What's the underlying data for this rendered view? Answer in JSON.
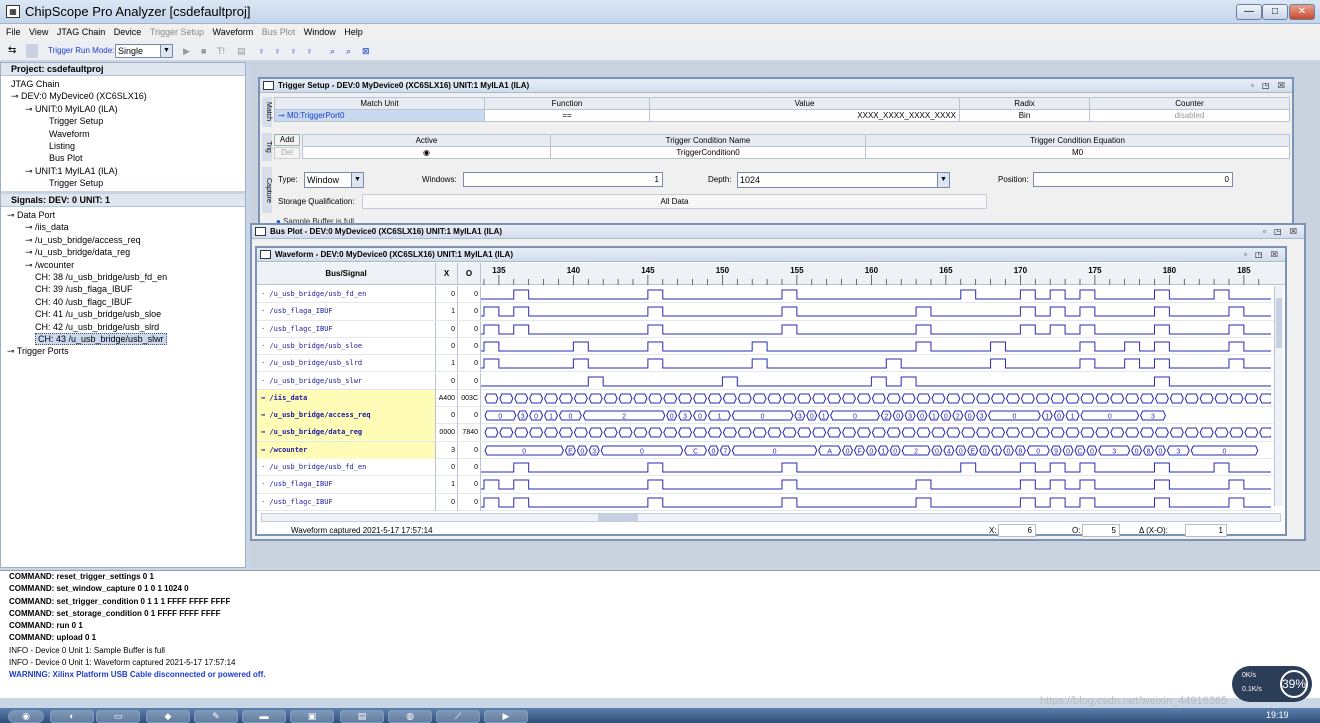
{
  "app": {
    "title": "ChipScope Pro Analyzer [csdefaultproj]"
  },
  "menu": [
    "File",
    "View",
    "JTAG Chain",
    "Device",
    "Trigger Setup",
    "Waveform",
    "Bus Plot",
    "Window",
    "Help"
  ],
  "toolbar": {
    "run_mode_label": "Trigger Run Mode:",
    "run_mode_value": "Single",
    "t_label": "T!"
  },
  "project": {
    "title": "Project: csdefaultproj",
    "tree": [
      "JTAG Chain",
      "DEV:0 MyDevice0 (XC6SLX16)",
      "UNIT:0 MyILA0 (ILA)",
      "Trigger Setup",
      "Waveform",
      "Listing",
      "Bus Plot",
      "UNIT:1 MyILA1 (ILA)",
      "Trigger Setup"
    ]
  },
  "signals": {
    "title": "Signals: DEV: 0 UNIT: 1",
    "tree": [
      "Data Port",
      "/iis_data",
      "/u_usb_bridge/access_req",
      "/u_usb_bridge/data_reg",
      "/wcounter",
      "CH: 38 /u_usb_bridge/usb_fd_en",
      "CH: 39 /usb_flaga_IBUF",
      "CH: 40 /usb_flagc_IBUF",
      "CH: 41 /u_usb_bridge/usb_sloe",
      "CH: 42 /u_usb_bridge/usb_slrd",
      "CH: 43 /u_usb_bridge/usb_slwr",
      "Trigger Ports"
    ]
  },
  "trigger_setup": {
    "title": "Trigger Setup - DEV:0 MyDevice0 (XC6SLX16) UNIT:1 MyILA1 (ILA)",
    "match_headers": [
      "Match Unit",
      "Function",
      "Value",
      "Radix",
      "Counter"
    ],
    "match_row": [
      "M0:TriggerPort0",
      "==",
      "XXXX_XXXX_XXXX_XXXX",
      "Bin",
      "disabled"
    ],
    "side_match": "Match",
    "side_trig": "Trig",
    "side_capture": "Capture",
    "add": "Add",
    "del": "Del",
    "trig_headers": [
      "Active",
      "Trigger Condition Name",
      "Trigger Condition Equation"
    ],
    "trig_row": [
      "◉",
      "TriggerCondition0",
      "M0"
    ],
    "type_label": "Type:",
    "type_value": "Window",
    "windows_label": "Windows:",
    "windows_value": "1",
    "depth_label": "Depth:",
    "depth_value": "1024",
    "position_label": "Position:",
    "position_value": "0",
    "storage_label": "Storage Qualification:",
    "storage_value": "All Data",
    "buffer_status": "Sample Buffer is full"
  },
  "bus_plot": {
    "title": "Bus Plot - DEV:0 MyDevice0 (XC6SLX16) UNIT:1 MyILA1 (ILA)"
  },
  "waveform": {
    "title": "Waveform - DEV:0 MyDevice0 (XC6SLX16) UNIT:1 MyILA1 (ILA)",
    "col_signal": "Bus/Signal",
    "col_x": "X",
    "col_o": "O",
    "ticks": [
      "135",
      "140",
      "145",
      "150",
      "155",
      "160",
      "165",
      "170",
      "175",
      "180",
      "185"
    ],
    "rows": [
      {
        "name": "/u_usb_bridge/usb_fd_en",
        "x": "0",
        "o": "0",
        "bus": false
      },
      {
        "name": "/usb_flaga_IBUF",
        "x": "1",
        "o": "0",
        "bus": false
      },
      {
        "name": "/usb_flagc_IBUF",
        "x": "0",
        "o": "0",
        "bus": false
      },
      {
        "name": "/u_usb_bridge/usb_sloe",
        "x": "0",
        "o": "0",
        "bus": false
      },
      {
        "name": "/u_usb_bridge/usb_slrd",
        "x": "1",
        "o": "0",
        "bus": false
      },
      {
        "name": "/u_usb_bridge/usb_slwr",
        "x": "0",
        "o": "0",
        "bus": false
      },
      {
        "name": "/iis_data",
        "x": "A400",
        "o": "003C",
        "bus": true
      },
      {
        "name": "/u_usb_bridge/access_req",
        "x": "0",
        "o": "0",
        "bus": true
      },
      {
        "name": "/u_usb_bridge/data_reg",
        "x": "0000",
        "o": "7840",
        "bus": true
      },
      {
        "name": "/wcounter",
        "x": "3",
        "o": "0",
        "bus": true
      },
      {
        "name": "/u_usb_bridge/usb_fd_en",
        "x": "0",
        "o": "0",
        "bus": false
      },
      {
        "name": "/usb_flaga_IBUF",
        "x": "1",
        "o": "0",
        "bus": false
      },
      {
        "name": "/usb_flagc_IBUF",
        "x": "0",
        "o": "0",
        "bus": false
      }
    ],
    "access_req_labels": [
      "0",
      "3",
      "0",
      "1",
      "0",
      "2",
      "0",
      "3",
      "0",
      "1",
      "0",
      "3",
      "0",
      "1",
      "0",
      "2",
      "0",
      "3",
      "0",
      "1",
      "0",
      "2",
      "0",
      "3",
      "0",
      "1",
      "0",
      "1",
      "0",
      "3"
    ],
    "wcounter_labels": [
      "0",
      "E",
      "0",
      "3",
      "0",
      "C",
      "0",
      "7",
      "0",
      "A",
      "0",
      "F",
      "0",
      "1",
      "0",
      "2",
      "0",
      "4",
      "0",
      "E",
      "0",
      "1",
      "0",
      "8",
      "0",
      "9",
      "0",
      "C",
      "0",
      "3",
      "0",
      "8",
      "0",
      "3",
      "0"
    ],
    "status": "Waveform captured 2021-5-17 17:57:14",
    "cursor_x_label": "X:",
    "cursor_x_value": "6",
    "cursor_o_label": "O:",
    "cursor_o_value": "5",
    "delta_label": "Δ (X-O):",
    "delta_value": "1",
    "colors": {
      "wave": "#2a2ab4",
      "bus_highlight": "#fffcb8"
    }
  },
  "console": [
    {
      "text": "COMMAND: reset_trigger_settings 0 1",
      "kind": "cmd"
    },
    {
      "text": "COMMAND: set_window_capture 0 1 0 1 1024 0",
      "kind": "cmd"
    },
    {
      "text": "COMMAND: set_trigger_condition 0 1 1 1 FFFF FFFF FFFF",
      "kind": "cmd"
    },
    {
      "text": "COMMAND: set_storage_condition 0 1 FFFF FFFF FFFF",
      "kind": "cmd"
    },
    {
      "text": "COMMAND: run 0 1",
      "kind": "cmd"
    },
    {
      "text": "COMMAND: upload 0 1",
      "kind": "cmd"
    },
    {
      "text": "INFO - Device 0 Unit 1:  Sample Buffer is full",
      "kind": "info"
    },
    {
      "text": "INFO - Device 0 Unit 1: Waveform captured 2021-5-17 17:57:14",
      "kind": "info"
    },
    {
      "text": "WARNING: Xilinx Platform USB Cable disconnected or powered off.",
      "kind": "warn"
    }
  ],
  "overlay": {
    "up": "0K/s",
    "down": "0.1K/s",
    "pct": "39%",
    "watermark": "https://blog.csdn.net/weixin_44916365",
    "clock": "19:19"
  }
}
